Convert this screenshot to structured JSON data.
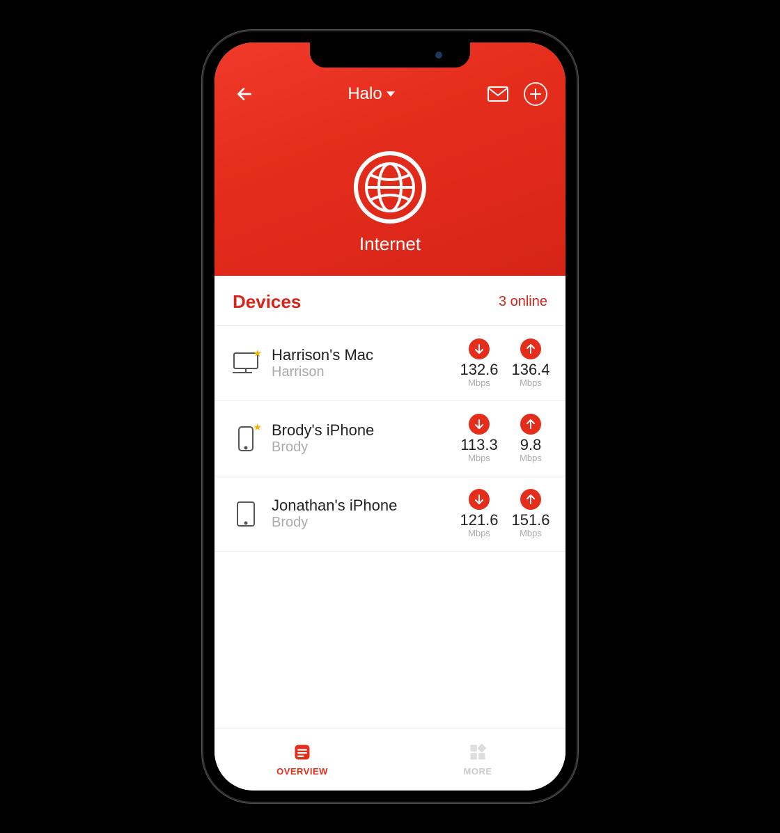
{
  "header": {
    "network_name": "Halo",
    "hero_label": "Internet"
  },
  "devices_section": {
    "title": "Devices",
    "online_status": "3 online"
  },
  "devices": [
    {
      "icon": "desktop",
      "starred": true,
      "name": "Harrison's Mac",
      "owner": "Harrison",
      "down_value": "132.6",
      "down_unit": "Mbps",
      "up_value": "136.4",
      "up_unit": "Mbps"
    },
    {
      "icon": "phone",
      "starred": true,
      "name": "Brody's iPhone",
      "owner": "Brody",
      "down_value": "113.3",
      "down_unit": "Mbps",
      "up_value": "9.8",
      "up_unit": "Mbps"
    },
    {
      "icon": "tablet",
      "starred": false,
      "name": "Jonathan's iPhone",
      "owner": "Brody",
      "down_value": "121.6",
      "down_unit": "Mbps",
      "up_value": "151.6",
      "up_unit": "Mbps"
    }
  ],
  "bottombar": {
    "overview_label": "OVERVIEW",
    "more_label": "MORE"
  },
  "colors": {
    "accent": "#e52d1c"
  }
}
